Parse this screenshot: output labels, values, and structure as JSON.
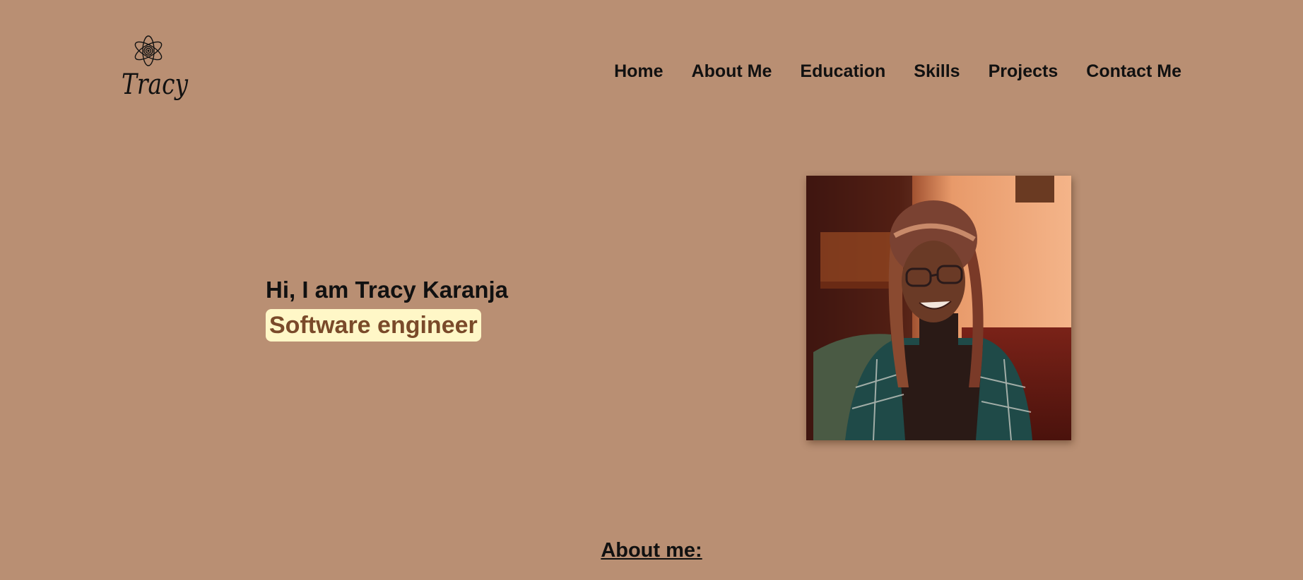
{
  "header": {
    "logo": {
      "icon": "atom-flower-icon",
      "text": "Tracy"
    },
    "nav": [
      {
        "label": "Home"
      },
      {
        "label": "About Me"
      },
      {
        "label": "Education"
      },
      {
        "label": "Skills"
      },
      {
        "label": "Projects"
      },
      {
        "label": "Contact Me"
      }
    ]
  },
  "hero": {
    "greeting": "Hi, I am Tracy Karanja",
    "role": "Software engineer",
    "photo_subject": "portrait-photo"
  },
  "about": {
    "heading": "About me:"
  },
  "colors": {
    "background": "#b98f73",
    "role_badge_bg": "#fff7c7",
    "role_text": "#7a4a2a",
    "text": "#111111"
  }
}
